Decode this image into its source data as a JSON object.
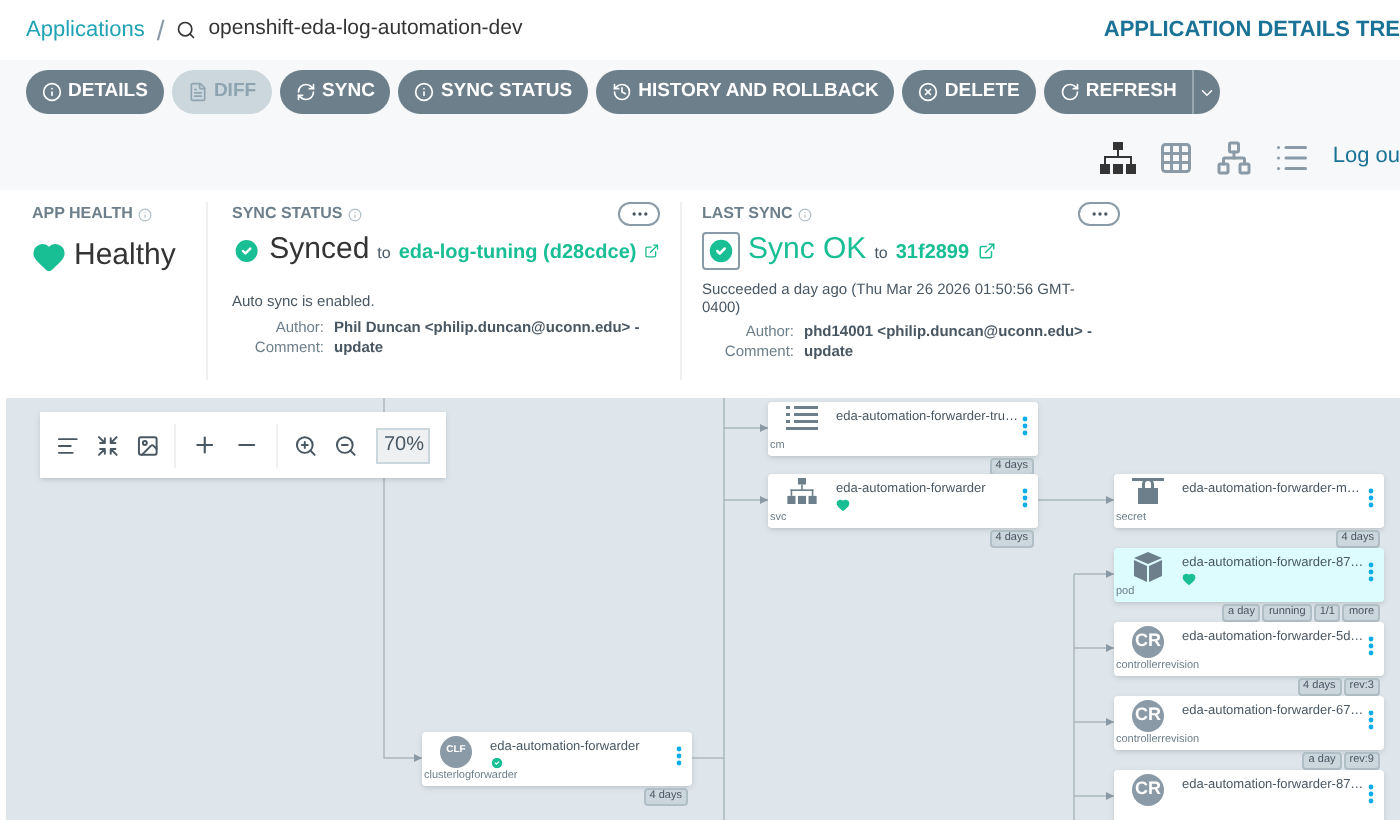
{
  "breadcrumb": {
    "root": "Applications",
    "separator": "/",
    "current": "openshift-eda-log-automation-dev"
  },
  "view_title": "APPLICATION DETAILS TRE",
  "toolbar": [
    {
      "label": "DETAILS",
      "kind": "info",
      "disabled": false,
      "dropdown": false
    },
    {
      "label": "DIFF",
      "kind": "file",
      "disabled": true,
      "dropdown": false
    },
    {
      "label": "SYNC",
      "kind": "sync",
      "disabled": false,
      "dropdown": false
    },
    {
      "label": "SYNC STATUS",
      "kind": "info",
      "disabled": false,
      "dropdown": false
    },
    {
      "label": "HISTORY AND ROLLBACK",
      "kind": "history",
      "disabled": false,
      "dropdown": false
    },
    {
      "label": "DELETE",
      "kind": "close",
      "disabled": false,
      "dropdown": false
    },
    {
      "label": "REFRESH",
      "kind": "refresh",
      "disabled": false,
      "dropdown": true
    }
  ],
  "view_icons": [
    {
      "kind": "tree",
      "selected": true
    },
    {
      "kind": "grid",
      "selected": false
    },
    {
      "kind": "network",
      "selected": false
    },
    {
      "kind": "list",
      "selected": false
    }
  ],
  "logout": "Log ou",
  "app_health": {
    "title": "APP HEALTH",
    "status": "Healthy"
  },
  "sync_status": {
    "title": "SYNC STATUS",
    "status": "Synced",
    "to": "to",
    "target": "eda-log-tuning (d28cdce)",
    "note": "Auto sync is enabled.",
    "author_label": "Author:",
    "author": "Phil Duncan <philip.duncan@uconn.edu> -",
    "comment_label": "Comment:",
    "comment": "update"
  },
  "last_sync": {
    "title": "LAST SYNC",
    "status": "Sync OK",
    "to": "to",
    "revision": "31f2899",
    "detail": "Succeeded a day ago (Thu Mar 26 2026 01:50:56 GMT-0400)",
    "author_label": "Author:",
    "author": "phd14001 <philip.duncan@uconn.edu> -",
    "comment_label": "Comment:",
    "comment": "update"
  },
  "graph": {
    "zoom": "70%",
    "nodes": [
      {
        "kind": "configmap",
        "name": "eda-automation-forwarder-tru…",
        "label": "cm",
        "healthy": false,
        "synced": false,
        "selected": false,
        "tags": [
          "4 days"
        ]
      },
      {
        "kind": "service",
        "name": "eda-automation-forwarder",
        "label": "svc",
        "healthy": true,
        "synced": false,
        "selected": false,
        "tags": [
          "4 days"
        ]
      },
      {
        "kind": "secret",
        "name": "eda-automation-forwarder-m…",
        "label": "secret",
        "healthy": false,
        "synced": false,
        "selected": false,
        "tags": [
          "4 days"
        ]
      },
      {
        "kind": "pod",
        "name": "eda-automation-forwarder-87…",
        "label": "pod",
        "healthy": true,
        "synced": false,
        "selected": true,
        "tags": [
          "a day",
          "running",
          "1/1",
          "more"
        ]
      },
      {
        "kind": "controllerrevision",
        "badge": "CR",
        "name": "eda-automation-forwarder-5d…",
        "label": "controllerrevision",
        "healthy": false,
        "synced": false,
        "selected": false,
        "tags": [
          "4 days",
          "rev:3"
        ]
      },
      {
        "kind": "controllerrevision",
        "badge": "CR",
        "name": "eda-automation-forwarder-67…",
        "label": "controllerrevision",
        "healthy": false,
        "synced": false,
        "selected": false,
        "tags": [
          "a day",
          "rev:9"
        ]
      },
      {
        "kind": "clusterlogforwarder",
        "badge": "CLF",
        "name": "eda-automation-forwarder",
        "label": "clusterlogforwarder",
        "healthy": false,
        "synced": true,
        "selected": false,
        "tags": [
          "4 days"
        ]
      },
      {
        "kind": "controllerrevision",
        "badge": "CR",
        "name": "eda-automation-forwarder-87…",
        "healthy": false,
        "synced": false,
        "selected": false
      }
    ]
  }
}
